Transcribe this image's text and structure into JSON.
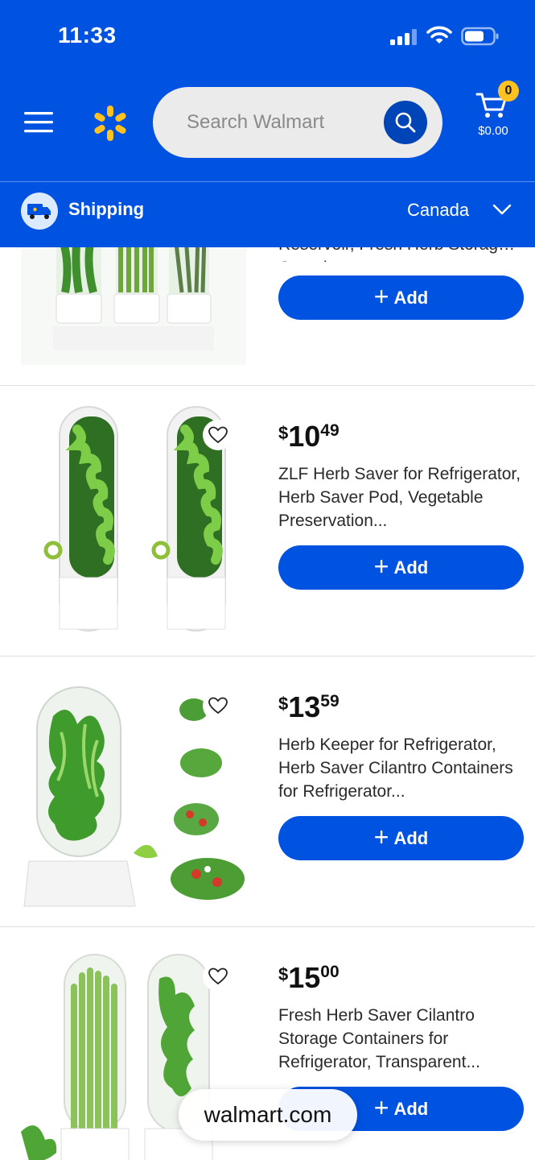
{
  "status_bar": {
    "time": "11:33"
  },
  "header": {
    "search_placeholder": "Search Walmart",
    "cart_count": "0",
    "cart_total": "$0.00",
    "brand_color": "#0052e0",
    "accent_color": "#ffc220"
  },
  "shipping": {
    "label": "Shipping",
    "country": "Canada"
  },
  "products": [
    {
      "title": "Reservoir, Fresh Herb Storage Containers",
      "add_label": "Add"
    },
    {
      "price_currency": "$",
      "price_whole": "10",
      "price_cents": "49",
      "title": "ZLF Herb Saver for Refrigerator, Herb Saver Pod, Vegetable Preservation...",
      "add_label": "Add"
    },
    {
      "price_currency": "$",
      "price_whole": "13",
      "price_cents": "59",
      "title": "Herb Keeper for Refrigerator, Herb Saver Cilantro Containers for Refrigerator...",
      "add_label": "Add"
    },
    {
      "price_currency": "$",
      "price_whole": "15",
      "price_cents": "00",
      "title": "Fresh Herb Saver Cilantro Storage Containers for Refrigerator, Transparent...",
      "add_label": "Add"
    }
  ],
  "browser": {
    "domain": "walmart.com"
  }
}
